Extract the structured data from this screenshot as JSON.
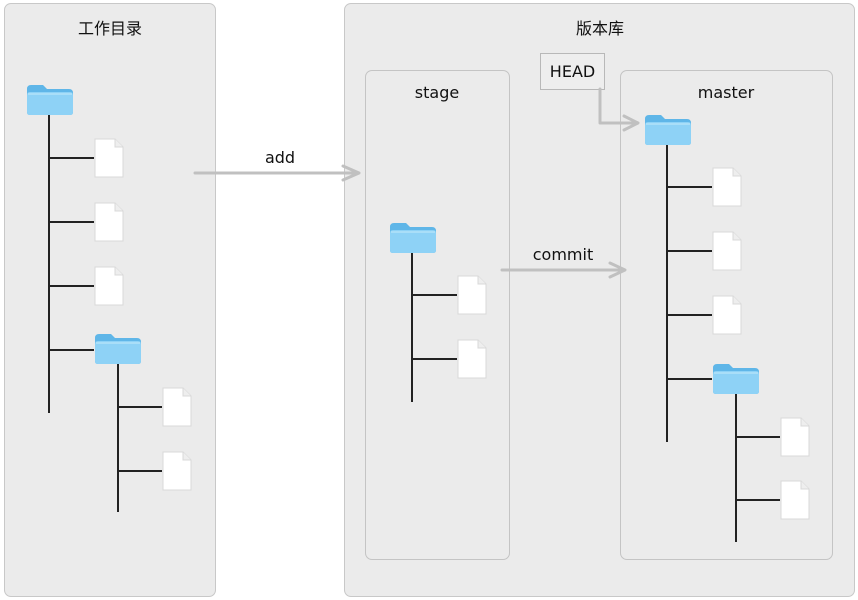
{
  "working_dir": {
    "title": "工作目录"
  },
  "repository": {
    "title": "版本库",
    "stage": {
      "title": "stage"
    },
    "master": {
      "title": "master"
    },
    "head_label": "HEAD"
  },
  "arrows": {
    "add_label": "add",
    "commit_label": "commit"
  },
  "colors": {
    "panel_bg": "#ebebeb",
    "folder": "#7cc8f2",
    "arrow": "#c0c0c0",
    "tree_line": "#222222"
  }
}
